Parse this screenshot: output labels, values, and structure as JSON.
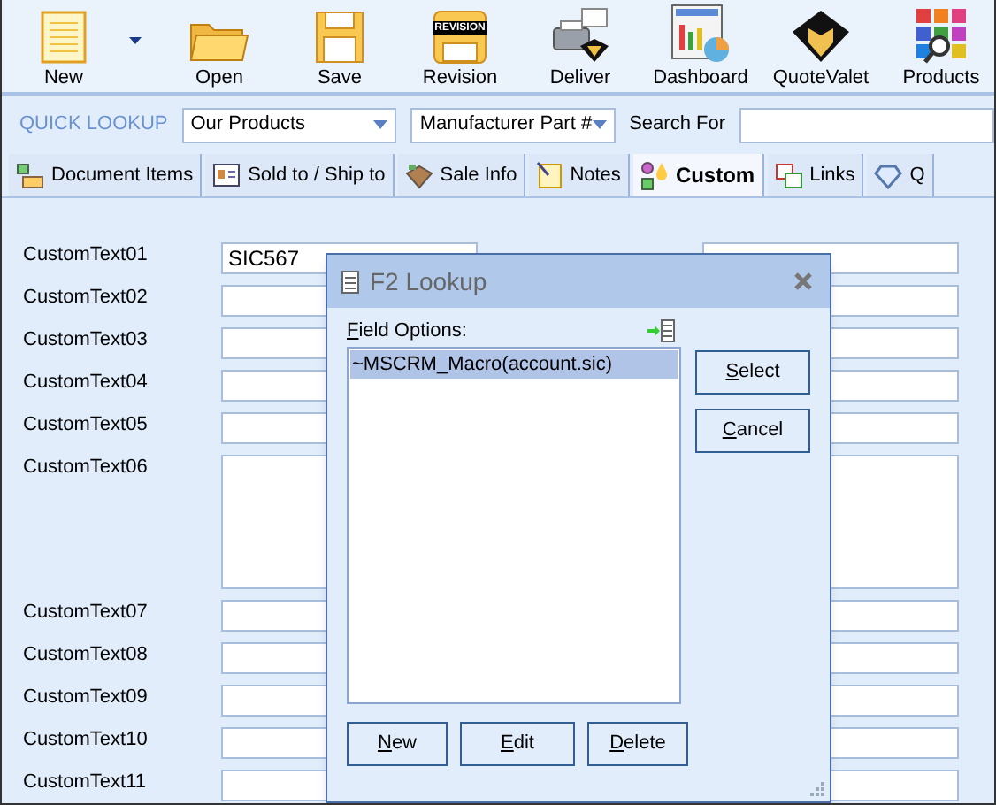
{
  "toolbar": {
    "buttons": [
      {
        "label": "New",
        "kind": "new",
        "has_dropdown": true
      },
      {
        "label": "Open",
        "kind": "open",
        "has_dropdown": false
      },
      {
        "label": "Save",
        "kind": "save",
        "has_dropdown": false
      },
      {
        "label": "Revision",
        "kind": "revision",
        "badge": "REVISION",
        "has_dropdown": false
      },
      {
        "label": "Deliver",
        "kind": "deliver",
        "has_dropdown": false
      },
      {
        "label": "Dashboard",
        "kind": "dashboard",
        "has_dropdown": false
      },
      {
        "label": "QuoteValet",
        "kind": "valet",
        "has_dropdown": false
      },
      {
        "label": "Products",
        "kind": "products",
        "has_dropdown": false
      }
    ]
  },
  "quick_lookup": {
    "label": "QUICK LOOKUP",
    "source": {
      "value": "Our Products"
    },
    "field": {
      "value": "Manufacturer Part #"
    },
    "search_label": "Search For"
  },
  "tabs": [
    {
      "label": "Document Items",
      "kind": "items",
      "selected": false
    },
    {
      "label": "Sold to / Ship to",
      "kind": "address",
      "selected": false
    },
    {
      "label": "Sale Info",
      "kind": "sale",
      "selected": false
    },
    {
      "label": "Notes",
      "kind": "notes",
      "selected": false
    },
    {
      "label": "Custom",
      "kind": "custom",
      "selected": true
    },
    {
      "label": "Links",
      "kind": "links",
      "selected": false
    },
    {
      "label": "Q",
      "kind": "diamond",
      "selected": false
    }
  ],
  "form": {
    "rows": [
      {
        "label": "CustomText01",
        "value": "SIC567",
        "multiline": false
      },
      {
        "label": "CustomText02",
        "multiline": false
      },
      {
        "label": "CustomText03",
        "multiline": false
      },
      {
        "label": "CustomText04",
        "multiline": false
      },
      {
        "label": "CustomText05",
        "multiline": false
      },
      {
        "label": "CustomText06",
        "multiline": true
      },
      {
        "label": "CustomText07",
        "multiline": false
      },
      {
        "label": "CustomText08",
        "multiline": false
      },
      {
        "label": "CustomText09",
        "multiline": false
      },
      {
        "label": "CustomText10",
        "multiline": false
      },
      {
        "label": "CustomText11",
        "multiline": false
      }
    ]
  },
  "dialog": {
    "title": "F2 Lookup",
    "list_label": {
      "text": "Field Options:",
      "underline_first": true
    },
    "options": [
      {
        "text": "~MSCRM_Macro(account.sic)",
        "selected": true
      }
    ],
    "side_buttons": [
      {
        "label": "Select",
        "underline_first": true
      },
      {
        "label": "Cancel",
        "underline_first": true
      }
    ],
    "bottom_buttons": [
      {
        "label": "New",
        "underline_first": true
      },
      {
        "label": "Edit",
        "underline_first": true
      },
      {
        "label": "Delete",
        "underline_first": true
      }
    ]
  }
}
